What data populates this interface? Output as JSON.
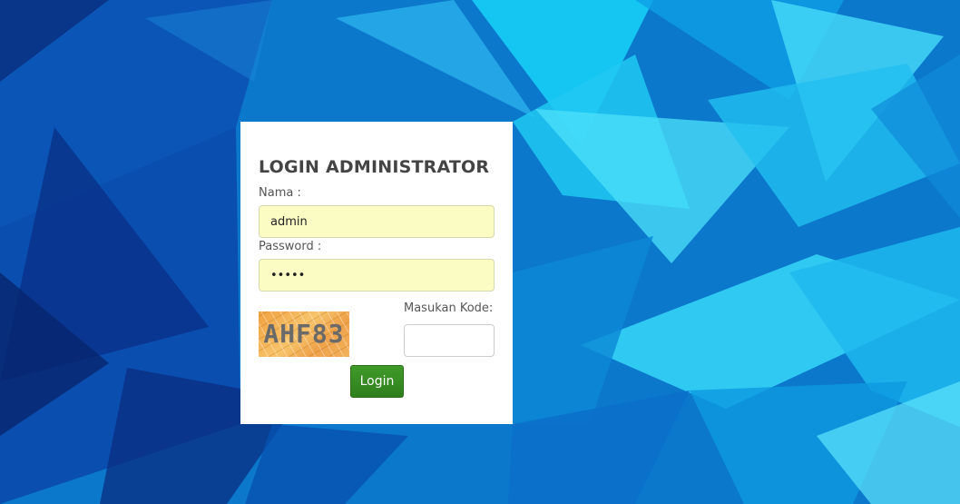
{
  "login": {
    "title": "LOGIN ADMINISTRATOR",
    "name_label": "Nama :",
    "name_value": "admin",
    "password_label": "Password :",
    "password_value": "admin",
    "captcha_text": "AHF83",
    "code_label": "Masukan Kode:",
    "code_value": "",
    "button_label": "Login"
  },
  "colors": {
    "background": "#0a74c8",
    "input_autofill": "#fafcc4",
    "button": "#35861f"
  }
}
